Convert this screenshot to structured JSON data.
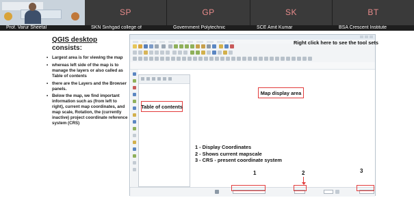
{
  "participants": [
    {
      "name": "Prof. Varur Sheetal",
      "initials": "",
      "has_video": true
    },
    {
      "name": "SKN Sinhgad college of",
      "initials": "SP",
      "color": "#e88b8b"
    },
    {
      "name": "Government Polytechnic",
      "initials": "GP",
      "color": "#e88b8b"
    },
    {
      "name": "SCE Amit Kumar",
      "initials": "SK",
      "color": "#e88b8b"
    },
    {
      "name": "BSA Crescent Institute",
      "initials": "BT",
      "color": "#e88b8b"
    }
  ],
  "slide": {
    "title": "QGIS desktop",
    "subtitle": "consists:",
    "bullets": [
      "Largest area is for viewing the map",
      "whereas left side of the map is to manage the layers or also called as Table of contents",
      "there are the Layers and the Browser panels.",
      "Below the map, we find important information such as (from left to right), current map coordinates, and map scale, Rotation, the (currently inactive) project coordinate reference system (CRS)"
    ],
    "bullet_glyph": "•"
  },
  "annotations": {
    "toc_label": "Table of contents",
    "map_label": "Map display area",
    "tools_note": "Right click here to see the tool sets",
    "legend": [
      "1 - Display Coordinates",
      "2 - Shows current mapscale",
      "3 - CRS - present coordinate system"
    ],
    "numbers": [
      "1",
      "2",
      "3"
    ]
  },
  "colors": {
    "annotation_red": "#e23b3b",
    "avatar_pink": "#e88b8b",
    "strip_bg": "#2c2c2c"
  }
}
